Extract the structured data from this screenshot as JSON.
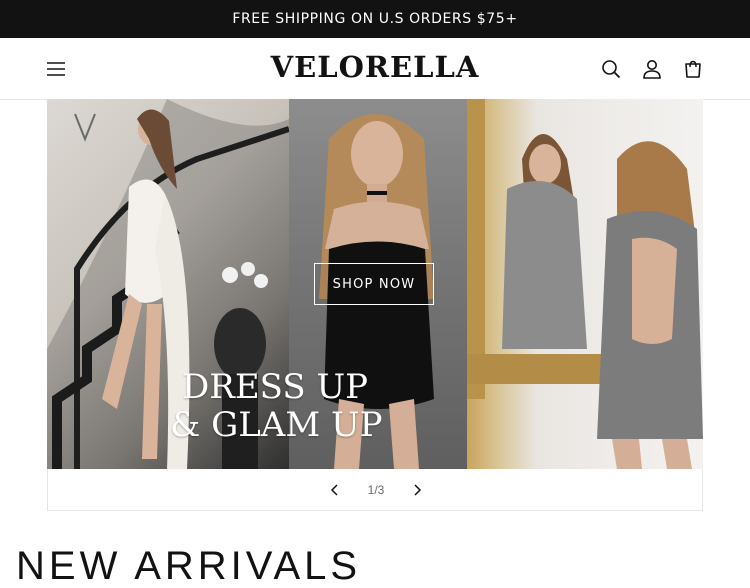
{
  "announcement": {
    "text": "FREE SHIPPING ON U.S ORDERS $75+"
  },
  "header": {
    "logo": "VELORELLA",
    "icons": {
      "menu": "menu-icon",
      "search": "search-icon",
      "account": "account-icon",
      "cart": "cart-icon"
    }
  },
  "hero": {
    "cta_label": "SHOP NOW",
    "heading_line1": "DRESS UP",
    "heading_line2": "& GLAM UP"
  },
  "slider": {
    "counter": "1/3",
    "current": 1,
    "total": 3
  },
  "section": {
    "title": "NEW ARRIVALS"
  },
  "colors": {
    "announcement_bg": "#121212",
    "text": "#121212",
    "background": "#ffffff"
  }
}
